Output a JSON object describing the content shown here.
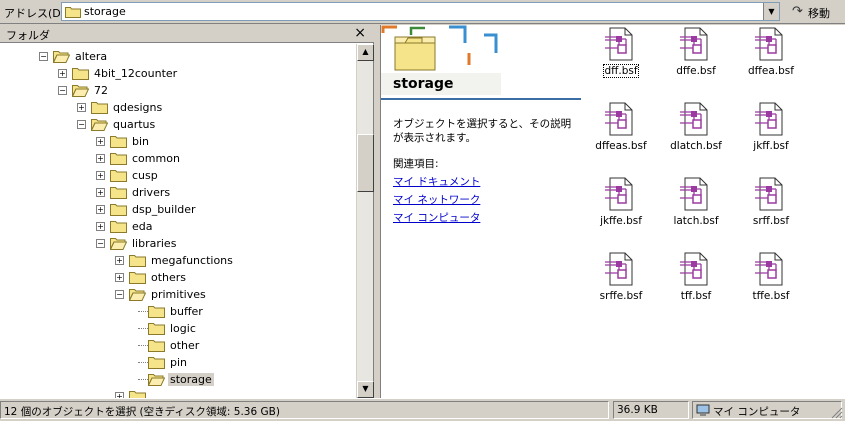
{
  "address": {
    "label": "アドレス(D)",
    "value": "storage",
    "go_label": "移動"
  },
  "folder_pane": {
    "title": "フォルダ",
    "close_glyph": "×",
    "items": [
      {
        "label": "altera",
        "level": 0,
        "state": "expanded"
      },
      {
        "label": "4bit_12counter",
        "level": 1,
        "state": "collapsed"
      },
      {
        "label": "72",
        "level": 1,
        "state": "expanded"
      },
      {
        "label": "qdesigns",
        "level": 2,
        "state": "collapsed"
      },
      {
        "label": "quartus",
        "level": 2,
        "state": "expanded"
      },
      {
        "label": "bin",
        "level": 3,
        "state": "collapsed"
      },
      {
        "label": "common",
        "level": 3,
        "state": "collapsed"
      },
      {
        "label": "cusp",
        "level": 3,
        "state": "collapsed"
      },
      {
        "label": "drivers",
        "level": 3,
        "state": "collapsed"
      },
      {
        "label": "dsp_builder",
        "level": 3,
        "state": "collapsed"
      },
      {
        "label": "eda",
        "level": 3,
        "state": "collapsed"
      },
      {
        "label": "libraries",
        "level": 3,
        "state": "expanded"
      },
      {
        "label": "megafunctions",
        "level": 4,
        "state": "collapsed"
      },
      {
        "label": "others",
        "level": 4,
        "state": "collapsed"
      },
      {
        "label": "primitives",
        "level": 4,
        "state": "expanded"
      },
      {
        "label": "buffer",
        "level": 5,
        "state": "leaf"
      },
      {
        "label": "logic",
        "level": 5,
        "state": "leaf"
      },
      {
        "label": "other",
        "level": 5,
        "state": "leaf"
      },
      {
        "label": "pin",
        "level": 5,
        "state": "leaf"
      },
      {
        "label": "storage",
        "level": 5,
        "state": "leaf-selected"
      }
    ]
  },
  "info_panel": {
    "title": "storage",
    "description": "オブジェクトを選択すると、その説明が表示されます。",
    "related_label": "関連項目:",
    "links": [
      "マイ ドキュメント",
      "マイ ネットワーク",
      "マイ コンピュータ"
    ]
  },
  "files": [
    "dff.bsf",
    "dffe.bsf",
    "dffea.bsf",
    "dffeas.bsf",
    "dlatch.bsf",
    "jkff.bsf",
    "jkffe.bsf",
    "latch.bsf",
    "srff.bsf",
    "srffe.bsf",
    "tff.bsf",
    "tffe.bsf"
  ],
  "statusbar": {
    "objects": "12 個のオブジェクトを選択 (空きディスク領域: 5.36 GB)",
    "size": "36.9 KB",
    "location": "マイ コンピュータ"
  },
  "colors": {
    "folder_yellow": "#f6e48a",
    "file_purple": "#9b3aa0",
    "link_blue": "#0000cc"
  }
}
